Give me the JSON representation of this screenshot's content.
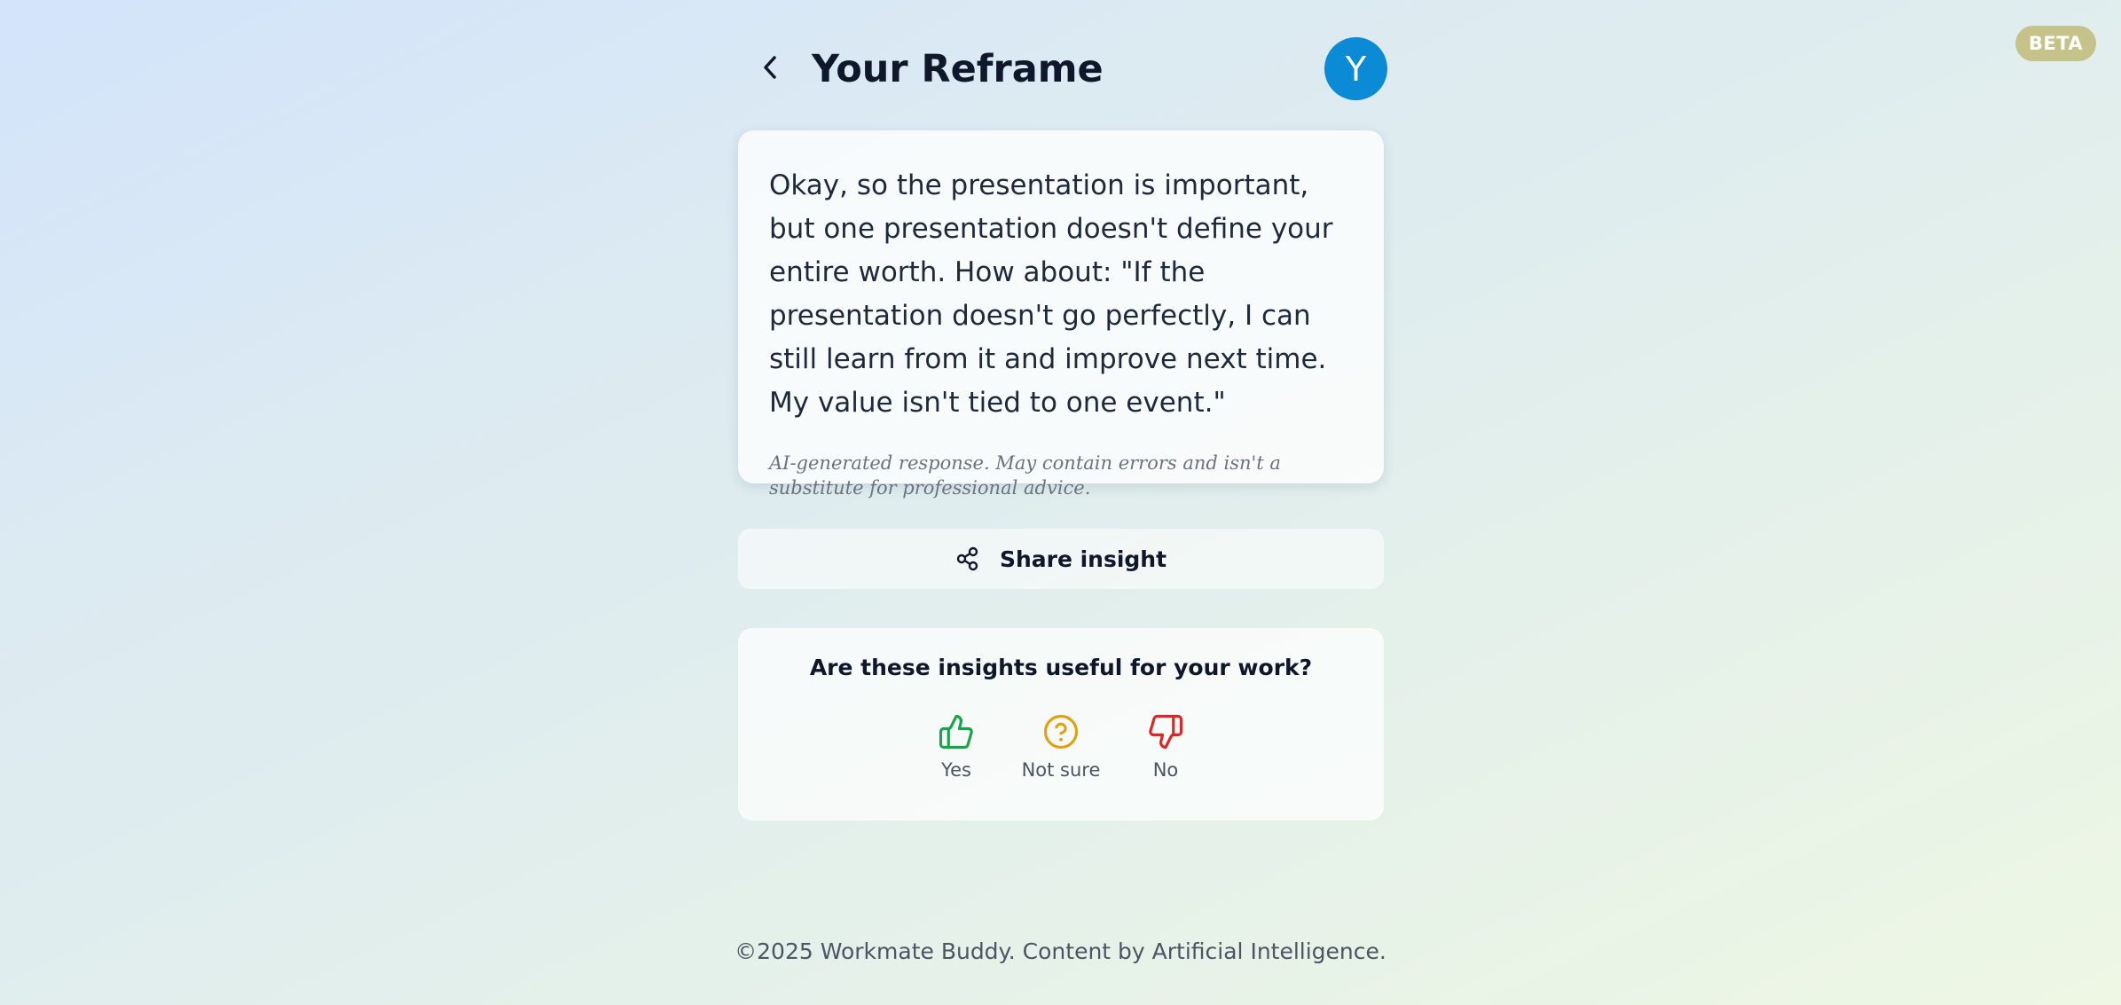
{
  "badge": {
    "label": "BETA",
    "color": "#c6c38a"
  },
  "header": {
    "back_icon": "chevron-left-icon",
    "title": "Your Reframe",
    "avatar_initial": "Y",
    "avatar_color": "#0b8bd6"
  },
  "reframe_card": {
    "text": "Okay, so the presentation is important, but one presentation doesn't define your entire worth. How about: \"If the presentation doesn't go perfectly, I can still learn from it and improve next time. My value isn't tied to one event.\"",
    "disclaimer": "AI-generated response. May contain errors and isn't a substitute for professional advice."
  },
  "share": {
    "icon": "share-icon",
    "label": "Share insight"
  },
  "feedback": {
    "question": "Are these insights useful for your work?",
    "options": [
      {
        "label": "Yes",
        "icon": "thumbs-up-icon",
        "color": "#16a34a"
      },
      {
        "label": "Not sure",
        "icon": "question-circle-icon",
        "color": "#e0a20f"
      },
      {
        "label": "No",
        "icon": "thumbs-down-icon",
        "color": "#dc2626"
      }
    ]
  },
  "footer": {
    "text": "©2025 Workmate Buddy. Content by Artificial Intelligence."
  }
}
